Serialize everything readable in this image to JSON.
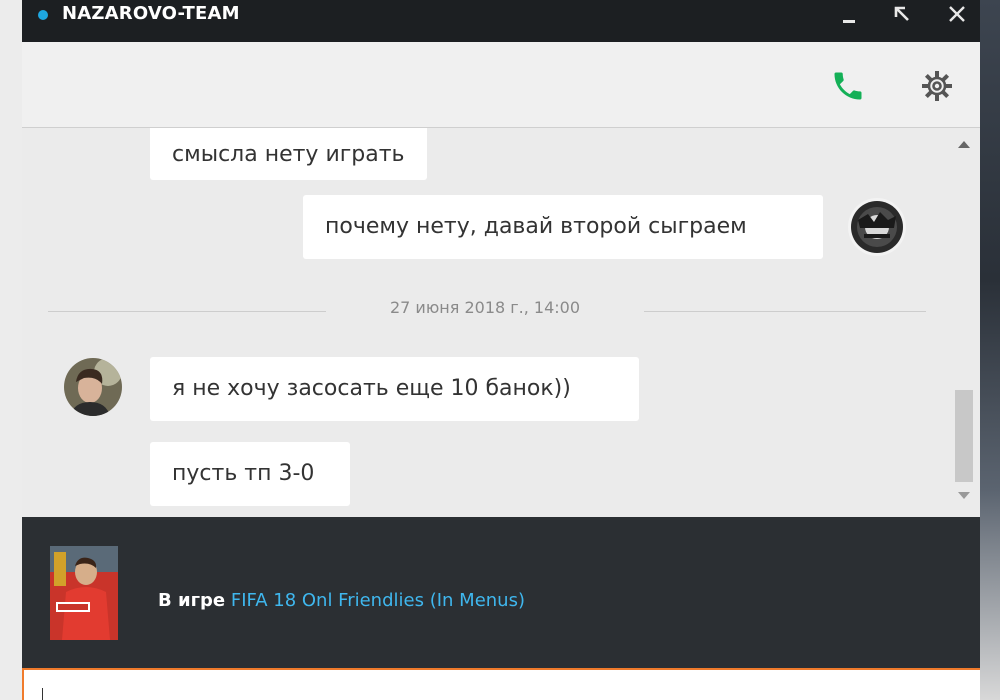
{
  "window": {
    "title": "NAZAROVO-TEAM",
    "status_color": "#1ea7e1",
    "controls": {
      "minimize": "_",
      "restore": "⇱",
      "close": "✕"
    }
  },
  "toolbar": {
    "call_icon": "phone-icon",
    "call_color": "#14b057",
    "settings_icon": "gear-icon"
  },
  "chat": {
    "messages": [
      {
        "side": "left",
        "text": "смысла нету играть"
      },
      {
        "side": "right",
        "text": "почему нету, давай второй сыграем"
      },
      {
        "side": "left",
        "text": "я не хочу засосать еще 10 банок))"
      },
      {
        "side": "left",
        "text": "пусть тп 3-0"
      }
    ],
    "date_separator": "27 июня 2018 г., 14:00"
  },
  "game_status": {
    "label": "В игре",
    "game_name": "FIFA 18 Onl Friendlies (In Menus)",
    "link_color": "#3fb7ee"
  },
  "input": {
    "value": ""
  },
  "colors": {
    "accent_input_border": "#f07b2c",
    "titlebar": "#1c1f22",
    "gamebar": "#2b2f33"
  }
}
